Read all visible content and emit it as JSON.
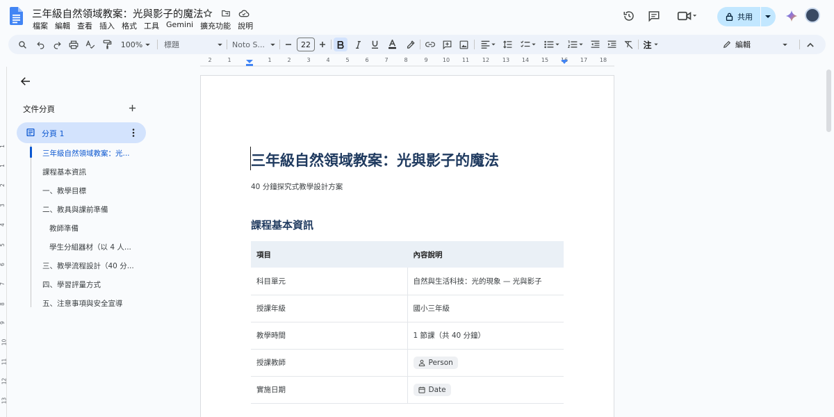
{
  "document": {
    "title": "三年級自然領域教案：光與影子的魔法"
  },
  "menu": [
    "檔案",
    "編輯",
    "查看",
    "插入",
    "格式",
    "工具",
    "Gemini",
    "擴充功能",
    "說明"
  ],
  "header_actions": {
    "share_label": "共用"
  },
  "toolbar": {
    "zoom": "100%",
    "paragraph_style": "標題",
    "font": "Noto S...",
    "font_size": "22",
    "edit_mode": "編輯",
    "chinese_ops_label": "注"
  },
  "ruler": {
    "numbers": [
      "2",
      "1",
      "1",
      "2",
      "3",
      "4",
      "5",
      "6",
      "7",
      "8",
      "9",
      "10",
      "11",
      "12",
      "13",
      "14",
      "15",
      "16",
      "17",
      "18"
    ],
    "vertical_numbers": [
      "1",
      "1",
      "2",
      "3",
      "4",
      "5",
      "6",
      "7",
      "8",
      "9",
      "10",
      "11",
      "12",
      "13"
    ]
  },
  "sidebar": {
    "heading": "文件分頁",
    "tab_label": "分頁 1",
    "outline": [
      {
        "label": "三年級自然領域教案：光...",
        "level": 1,
        "active": true
      },
      {
        "label": "課程基本資訊",
        "level": 1,
        "active": false
      },
      {
        "label": "一、教學目標",
        "level": 1,
        "active": false
      },
      {
        "label": "二、教具與課前準備",
        "level": 1,
        "active": false
      },
      {
        "label": "教師準備",
        "level": 2,
        "active": false
      },
      {
        "label": "學生分組器材（以 4 人...",
        "level": 2,
        "active": false
      },
      {
        "label": "三、教學流程設計（40 分...",
        "level": 1,
        "active": false
      },
      {
        "label": "四、學習評量方式",
        "level": 1,
        "active": false
      },
      {
        "label": "五、注意事項與安全宣導",
        "level": 1,
        "active": false
      }
    ]
  },
  "page": {
    "heading": "三年級自然領域教案：光與影子的魔法",
    "subtitle": "40 分鐘探究式教學設計方案",
    "section_heading": "課程基本資訊",
    "table": {
      "headers": [
        "項目",
        "內容說明"
      ],
      "rows": [
        [
          "科目單元",
          "自然與生活科技：光的現象 — 光與影子"
        ],
        [
          "授課年級",
          "國小三年級"
        ],
        [
          "教學時間",
          "1 節課（共 40 分鐘）"
        ],
        [
          "授課教師",
          "Person"
        ],
        [
          "實施日期",
          "Date"
        ]
      ]
    }
  },
  "colors": {
    "accent": "#0b57d0",
    "share_bg": "#c2e7ff",
    "toolbar_bg": "#edf2fa",
    "heading": "#1f3a5f",
    "table_header_bg": "#eaf0f6"
  }
}
